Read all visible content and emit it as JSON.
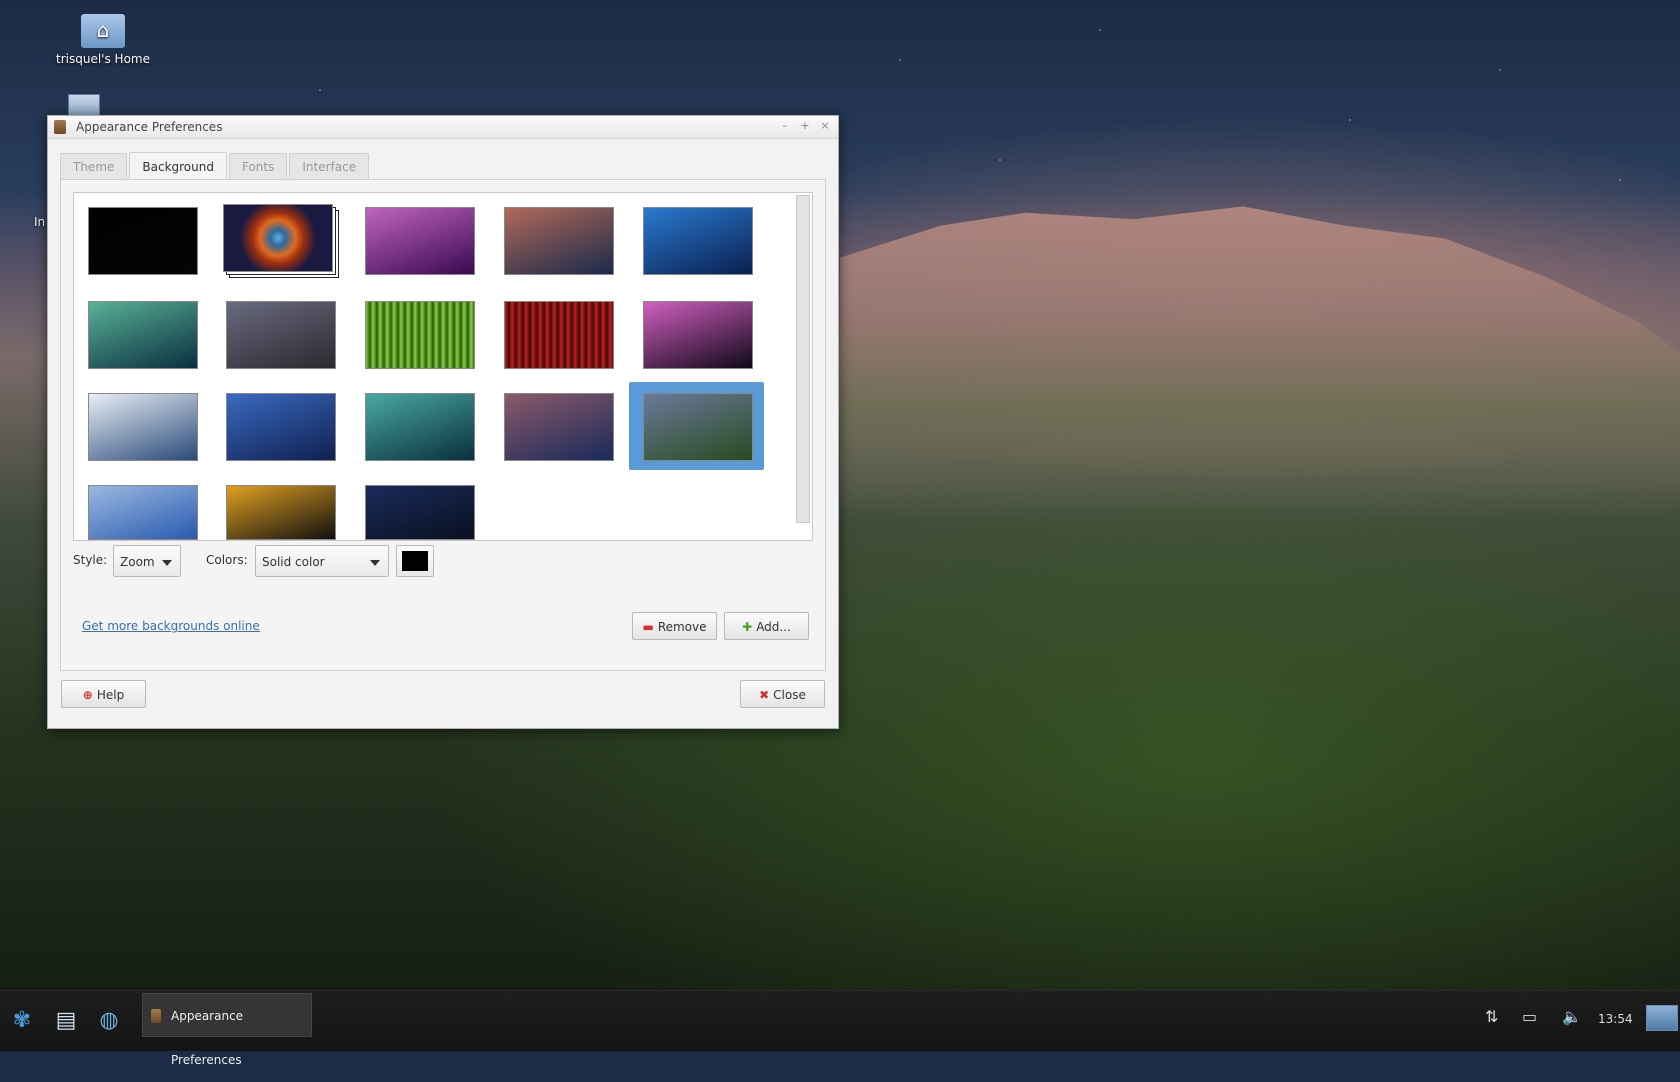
{
  "desktop": {
    "icons": [
      {
        "label": "trisquel's Home",
        "icon": "home-folder-icon"
      },
      {
        "label": "",
        "icon": "network-icon"
      },
      {
        "label": "In",
        "icon": "partial-icon"
      }
    ]
  },
  "window": {
    "title": "Appearance Preferences",
    "controls": {
      "minimize": "–",
      "maximize": "+",
      "close": "×"
    },
    "tabs": [
      {
        "label": "Theme",
        "active": false
      },
      {
        "label": "Background",
        "active": true
      },
      {
        "label": "Fonts",
        "active": false
      },
      {
        "label": "Interface",
        "active": false
      }
    ],
    "gallery": {
      "selected_index": 14,
      "thumbnails": [
        {
          "name": "black",
          "colors": [
            "#000000",
            "#050505"
          ]
        },
        {
          "name": "helix-nebula",
          "colors": [
            "#e06a20",
            "#1a1a40"
          ]
        },
        {
          "name": "purple-swirl",
          "colors": [
            "#c064c0",
            "#3a0a50"
          ]
        },
        {
          "name": "dark-flare",
          "colors": [
            "#b06a5a",
            "#1a2a4a"
          ]
        },
        {
          "name": "blue-swirl",
          "colors": [
            "#2a7ad0",
            "#0a2050"
          ]
        },
        {
          "name": "teal-glow",
          "colors": [
            "#5ab096",
            "#0a3040"
          ]
        },
        {
          "name": "bare-trees",
          "colors": [
            "#6a6a80",
            "#2a2a30"
          ]
        },
        {
          "name": "green-stripes",
          "colors": [
            "#8ad040",
            "#2a5a10"
          ]
        },
        {
          "name": "red-stripes",
          "colors": [
            "#c02020",
            "#400808"
          ]
        },
        {
          "name": "pink-light",
          "colors": [
            "#d060c0",
            "#100818"
          ]
        },
        {
          "name": "clouds-sea",
          "colors": [
            "#e8eef4",
            "#2a4a7a"
          ]
        },
        {
          "name": "blue-water",
          "colors": [
            "#3a6ac0",
            "#102050"
          ]
        },
        {
          "name": "teal-water",
          "colors": [
            "#4aa8a0",
            "#0a3040"
          ]
        },
        {
          "name": "dusk-water",
          "colors": [
            "#8a5a6a",
            "#1a2a5a"
          ]
        },
        {
          "name": "mountain-dusk",
          "colors": [
            "#6a7a9a",
            "#2a4a20"
          ]
        },
        {
          "name": "blue-waves",
          "colors": [
            "#9ab8e0",
            "#2a5ab0"
          ]
        },
        {
          "name": "light-streaks",
          "colors": [
            "#e0a020",
            "#101010"
          ]
        },
        {
          "name": "night-plants",
          "colors": [
            "#1a2a5a",
            "#0a1020"
          ]
        }
      ]
    },
    "style": {
      "label": "Style:",
      "value": "Zoom"
    },
    "colors": {
      "label": "Colors:",
      "value": "Solid color",
      "swatch": "#000000"
    },
    "more_link": "Get more backgrounds online",
    "buttons": {
      "remove": "Remove",
      "add": "Add...",
      "help": "Help",
      "close": "Close"
    }
  },
  "taskbar": {
    "task_label": "Appearance Preferences",
    "clock": "13:54",
    "icons": [
      "menu-icon",
      "file-manager-icon",
      "web-browser-icon"
    ],
    "tray": [
      "network-icon",
      "battery-icon",
      "volume-icon",
      "show-desktop-icon"
    ]
  }
}
